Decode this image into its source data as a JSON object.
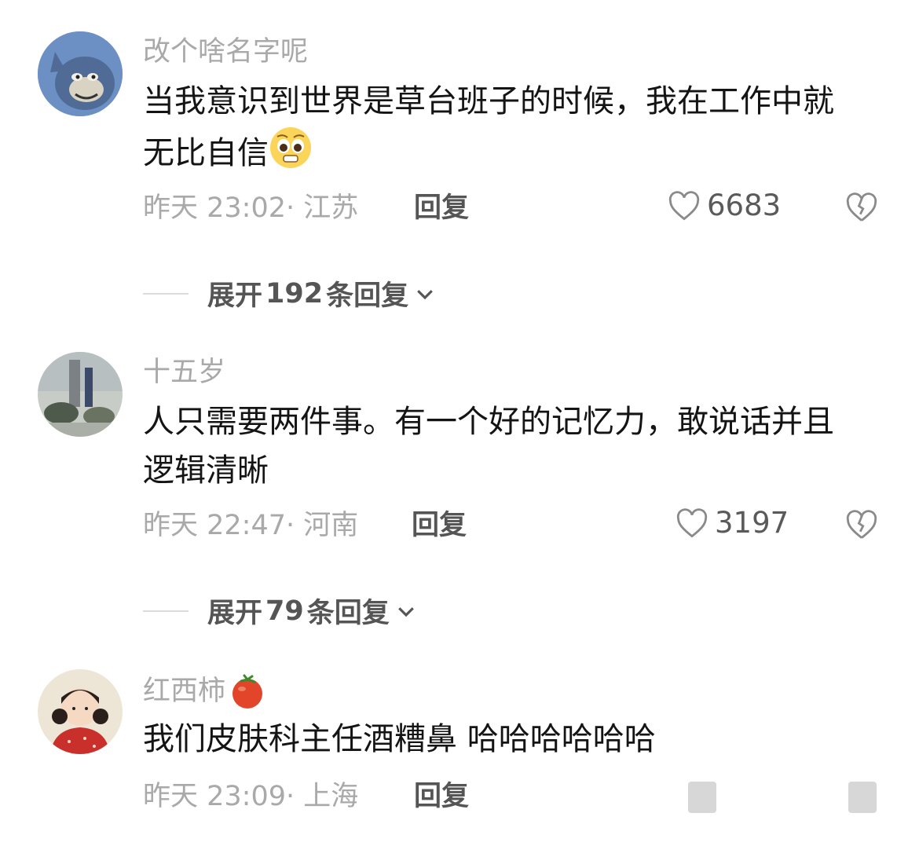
{
  "comments": [
    {
      "username": "改个啥名字呢",
      "content": "当我意识到世界是草台班子的时候，我在工作中就无比自信",
      "emoji": "pleading-face-emoji",
      "time": "昨天 23:02",
      "location": "· 江苏",
      "reply_label": "回复",
      "likes": "6683",
      "expand": {
        "prefix": "展开",
        "count": "192",
        "suffix": "条回复"
      }
    },
    {
      "username": "十五岁",
      "content": "人只需要两件事。有一个好的记忆力，敢说话并且逻辑清晰",
      "time": "昨天 22:47",
      "location": "· 河南",
      "reply_label": "回复",
      "likes": "3197",
      "expand": {
        "prefix": "展开",
        "count": "79",
        "suffix": "条回复"
      }
    },
    {
      "username": "红西柿",
      "username_emoji": "tomato-emoji",
      "content": "我们皮肤科主任酒糟鼻 哈哈哈哈哈哈",
      "time": "昨天 23:09",
      "location": "· 上海",
      "reply_label": "回复"
    }
  ],
  "colors": {
    "meta_gray": "#a9a9a9",
    "text": "#141414",
    "button": "#555555"
  }
}
